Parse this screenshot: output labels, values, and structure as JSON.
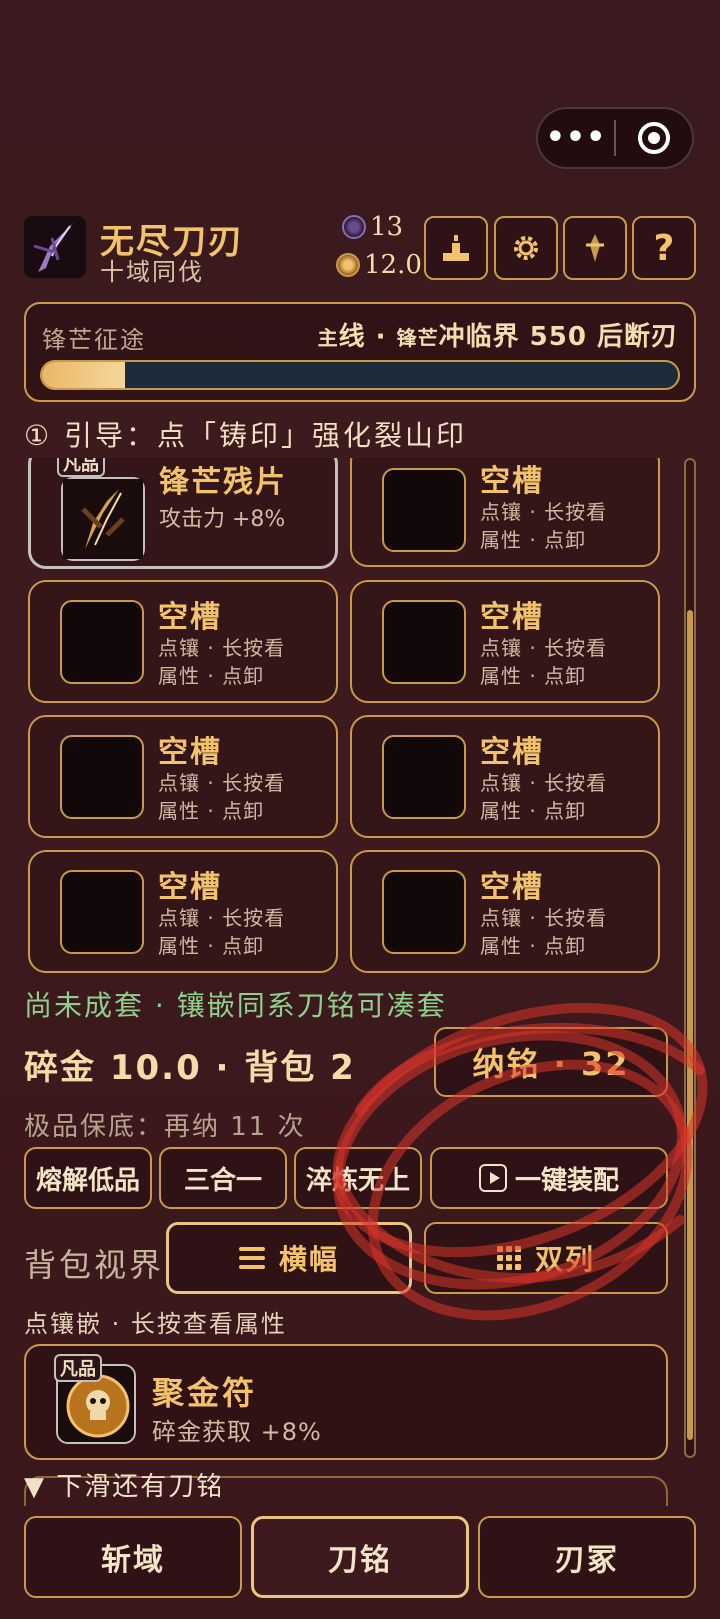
{
  "header": {
    "title": "无尽刀刃",
    "subtitle": "十域同伐",
    "stat_a": "13",
    "stat_b": "12.0",
    "buttons": [
      "rank-icon",
      "gear-icon",
      "blade-icon",
      "?"
    ]
  },
  "progress": {
    "label": "锋芒征途",
    "goal_prefix": "主",
    "goal_1": "线",
    "goal_dot": " · ",
    "goal_2": "锋",
    "goal_3": "芒",
    "goal_main": "冲临界 550 后断刃",
    "fraction": 0.13
  },
  "guide": "① 引导：点「铸印」强化裂山印",
  "slots": {
    "filled": {
      "badge": "凡品",
      "name": "锋芒残片",
      "stat": "攻击力 +8%"
    },
    "empty": {
      "name": "空槽",
      "line1": "点镶 · 长按看",
      "line2": "属性 · 点卸"
    }
  },
  "set_status": "尚未成套 · 镶嵌同系刀铭可凑套",
  "money_line": "碎金 10.0 · 背包 2",
  "collect_button": "纳铭 · 32",
  "pity": "极品保底：再纳 11 次",
  "actions": {
    "melt": "熔解低品",
    "merge": "三合一",
    "refine": "淬炼无上",
    "equip": "一键装配"
  },
  "view": {
    "label": "背包视界",
    "wide": "横幅",
    "double": "双列"
  },
  "hint": "点镶嵌 · 长按查看属性",
  "item": {
    "badge": "凡品",
    "name": "聚金符",
    "effect": "碎金获取 +8%"
  },
  "more": "▼ 下滑还有刀铭",
  "tabs": [
    "斩域",
    "刀铭",
    "刃冢"
  ],
  "colors": {
    "gold": "#f2c36a",
    "border": "#c99a4a",
    "green": "#8ed08c",
    "bg": "#3a1a1e",
    "progress_track": "#1d2b3a",
    "scribble": "#d9352a"
  }
}
